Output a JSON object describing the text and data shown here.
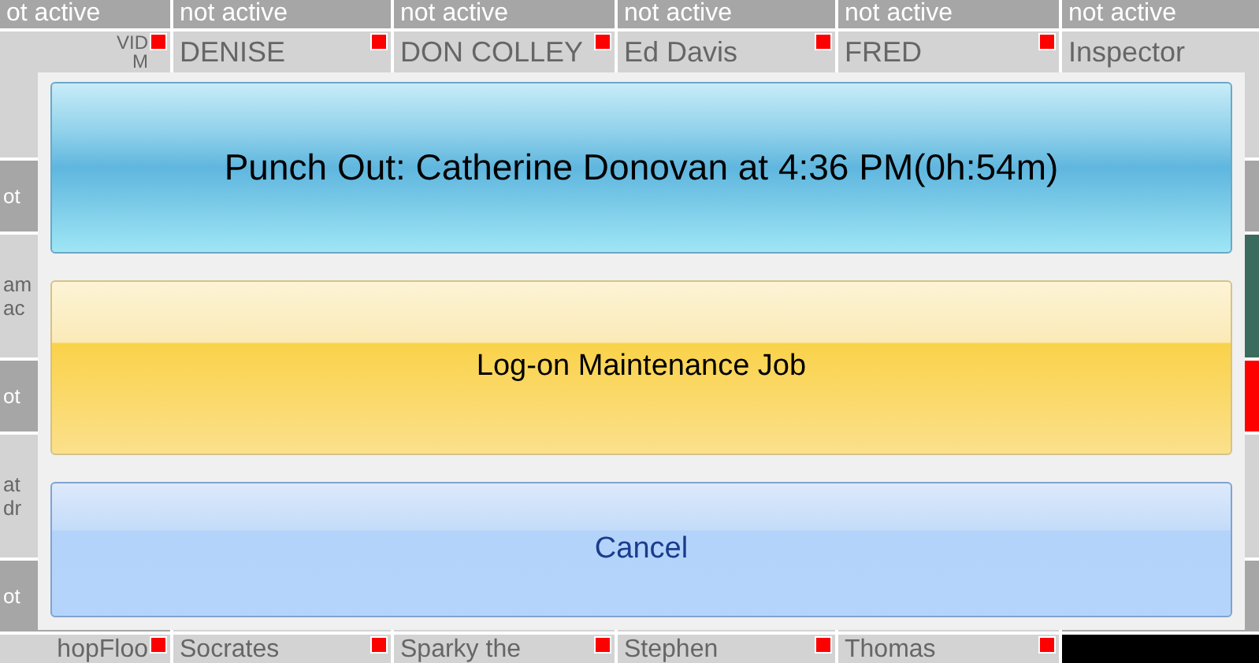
{
  "top_status": [
    "ot active",
    "not active",
    "not active",
    "not active",
    "not active",
    "not active"
  ],
  "name_tiles": [
    {
      "lines": [
        "VID",
        "M"
      ],
      "flag": true
    },
    {
      "lines": [
        "DENISE"
      ],
      "flag": true
    },
    {
      "lines": [
        "DON COLLEY"
      ],
      "flag": true
    },
    {
      "lines": [
        "Ed Davis"
      ],
      "flag": true
    },
    {
      "lines": [
        "FRED"
      ],
      "flag": true
    },
    {
      "lines": [
        "Inspector"
      ]
    }
  ],
  "left_edge": [
    {
      "kind": "status",
      "lines": [
        "ot"
      ]
    },
    {
      "kind": "name",
      "lines": [
        "am",
        "ac"
      ]
    },
    {
      "kind": "status",
      "lines": [
        "ot"
      ]
    },
    {
      "kind": "name",
      "lines": [
        "at",
        "dr"
      ]
    },
    {
      "kind": "status",
      "lines": [
        "ot"
      ]
    }
  ],
  "right_edge": [
    {
      "kind": "status"
    },
    {
      "kind": "photo"
    },
    {
      "kind": "alert"
    },
    {
      "kind": "name"
    },
    {
      "kind": "status"
    }
  ],
  "bottom_tiles": [
    {
      "kind": "name",
      "lines": [
        "hopFloo"
      ],
      "flag": true
    },
    {
      "kind": "name",
      "lines": [
        "Socrates"
      ],
      "flag": true
    },
    {
      "kind": "name",
      "lines": [
        "Sparky the"
      ],
      "flag": true
    },
    {
      "kind": "name",
      "lines": [
        "Stephen"
      ],
      "flag": true
    },
    {
      "kind": "name",
      "lines": [
        "Thomas"
      ],
      "flag": true
    },
    {
      "kind": "dark"
    }
  ],
  "dialog": {
    "buttons": [
      {
        "kind": "punch",
        "label": "Punch Out: Catherine Donovan at 4:36 PM(0h:54m)"
      },
      {
        "kind": "maintenance",
        "label": "Log-on Maintenance Job"
      },
      {
        "kind": "cancel",
        "label": "Cancel"
      }
    ]
  }
}
